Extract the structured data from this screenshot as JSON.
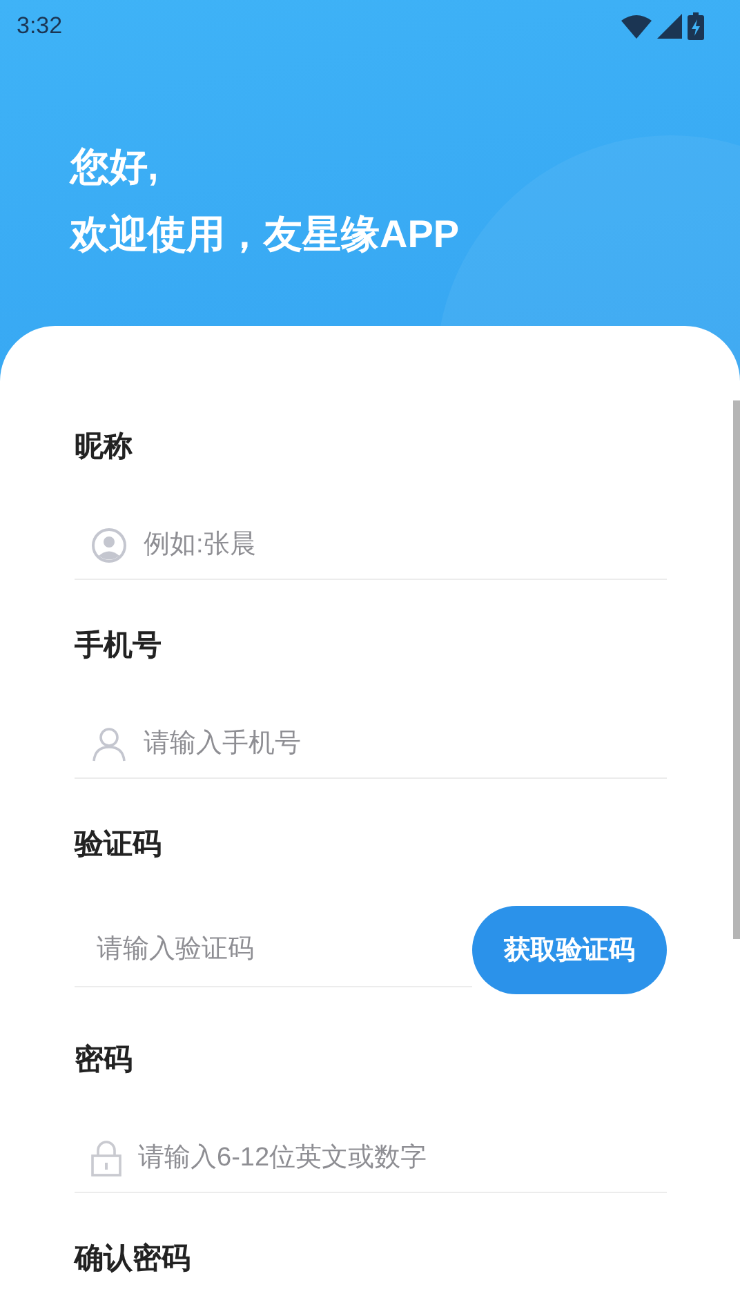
{
  "status_bar": {
    "time": "3:32"
  },
  "greeting": [
    "您好,",
    "欢迎使用，友星缘APP"
  ],
  "fields": [
    {
      "kind": "nickname",
      "label": "昵称",
      "placeholder": "例如:张晨"
    },
    {
      "kind": "phone",
      "label": "手机号",
      "placeholder": "请输入手机号"
    },
    {
      "kind": "code",
      "label": "验证码",
      "placeholder": "请输入验证码",
      "button": "获取验证码"
    },
    {
      "kind": "password",
      "label": "密码",
      "placeholder": "请输入6-12位英文或数字"
    },
    {
      "kind": "confirm",
      "label": "确认密码"
    }
  ]
}
